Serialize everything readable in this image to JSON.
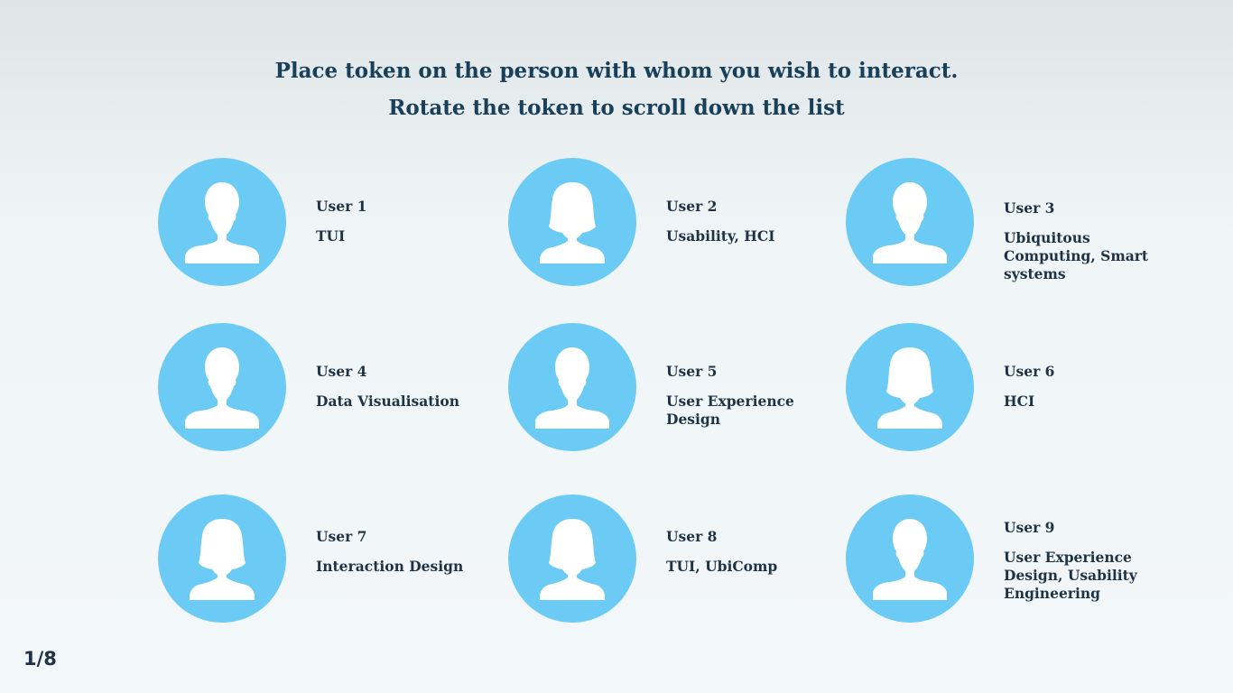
{
  "instructions": {
    "line1": "Place token on the person with whom you wish to interact.",
    "line2": "Rotate the token to scroll down the list"
  },
  "colors": {
    "avatar_bg": "#6ccbf4",
    "silhouette": "#ffffff",
    "text": "#1e3346"
  },
  "users": [
    {
      "name": "User 1",
      "topic": "TUI",
      "avatar": "male-avatar-icon"
    },
    {
      "name": "User 2",
      "topic": "Usability, HCI",
      "avatar": "female-avatar-icon"
    },
    {
      "name": "User 3",
      "topic": "Ubiquitous Computing, Smart systems",
      "avatar": "male-avatar-icon"
    },
    {
      "name": "User 4",
      "topic": "Data Visualisation",
      "avatar": "male-avatar-icon"
    },
    {
      "name": "User 5",
      "topic": "User Experience Design",
      "avatar": "male-avatar-icon"
    },
    {
      "name": "User 6",
      "topic": "HCI",
      "avatar": "female-avatar-icon"
    },
    {
      "name": "User 7",
      "topic": "Interaction Design",
      "avatar": "female-avatar-icon"
    },
    {
      "name": "User 8",
      "topic": "TUI, UbiComp",
      "avatar": "female-avatar-icon"
    },
    {
      "name": "User 9",
      "topic": "User Experience Design, Usability Engineering",
      "avatar": "male-avatar-icon"
    }
  ],
  "pagination": {
    "label": "1/8"
  }
}
